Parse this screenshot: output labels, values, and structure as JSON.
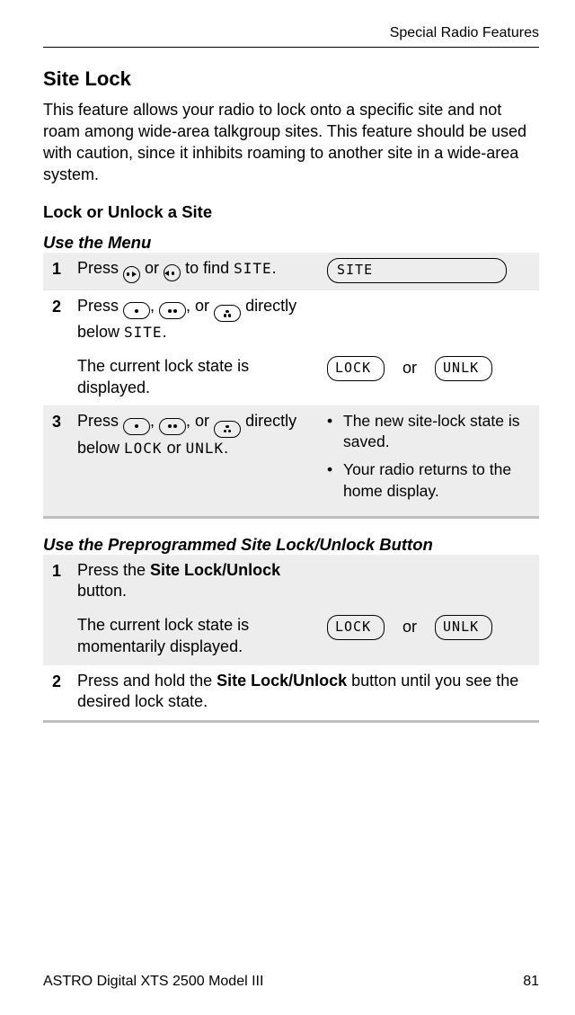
{
  "header": {
    "section_label": "Special Radio Features"
  },
  "section": {
    "title": "Site Lock",
    "description": "This feature allows your radio to lock onto a specific site and not roam among wide-area talkgroup sites. This feature should be used with caution, since it inhibits roaming to another site in a wide-area system.",
    "subtitle": "Lock or Unlock a Site"
  },
  "menu": {
    "heading": "Use the Menu",
    "steps": {
      "s1": {
        "num": "1",
        "text_pre": "Press ",
        "text_mid": " or ",
        "text_post": " to find ",
        "code": "SITE",
        "period": ".",
        "display": "SITE"
      },
      "s2a": {
        "num": "2",
        "text_pre": "Press ",
        "comma1": ", ",
        "comma2": ", or ",
        "text_post": " directly below ",
        "code": "SITE",
        "period": "."
      },
      "s2b": {
        "text": "The current lock state is displayed.",
        "disp1": "LOCK",
        "or": "or",
        "disp2": "UNLK"
      },
      "s3": {
        "num": "3",
        "text_pre": "Press ",
        "comma1": ", ",
        "comma2": ", or ",
        "text_post": " directly below ",
        "code1": "LOCK",
        "or": " or ",
        "code2": "UNLK",
        "period": ".",
        "bullet1": "The new site-lock state is saved.",
        "bullet2": "Your radio returns to the home display."
      }
    }
  },
  "button": {
    "heading": "Use the Preprogrammed Site Lock/Unlock Button",
    "steps": {
      "s1a": {
        "num": "1",
        "text_pre": "Press the ",
        "bold": "Site Lock/Unlock",
        "text_post": " button."
      },
      "s1b": {
        "text": "The current lock state is momentarily displayed.",
        "disp1": "LOCK",
        "or": "or",
        "disp2": "UNLK"
      },
      "s2": {
        "num": "2",
        "text_pre": "Press and hold the ",
        "bold": "Site Lock/Unlock",
        "text_post": " button until you see the desired lock state."
      }
    }
  },
  "footer": {
    "product": "ASTRO Digital XTS 2500 Model III",
    "page": "81"
  }
}
